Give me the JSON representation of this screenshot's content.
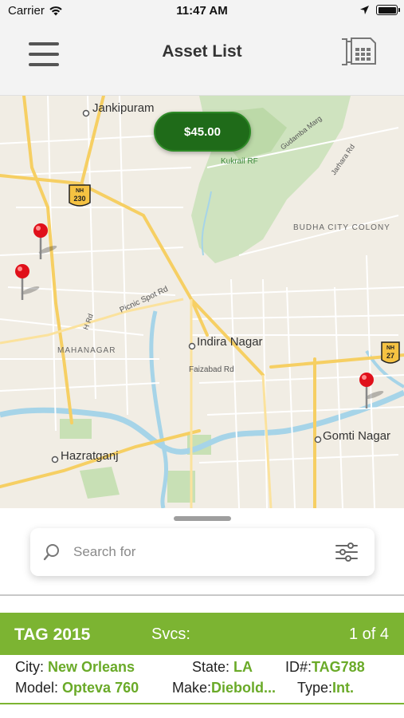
{
  "status_bar": {
    "carrier": "Carrier",
    "time": "11:47 AM"
  },
  "nav": {
    "title": "Asset List",
    "menu_icon": "hamburger-menu-icon",
    "right_icon": "sim-card-icon"
  },
  "map": {
    "price_badge": "$45.00",
    "labels": {
      "jankipuram": "Jankipuram",
      "kukrail": "Kukrail RF",
      "gudamba": "Gudamba Marg",
      "jarhara": "Jarhara Rd",
      "budha": "BUDHA CITY COLONY",
      "picnic": "Picnic Spot Rd",
      "hrd": "H Rd",
      "mahanagar": "MAHANAGAR",
      "indira": "Indira Nagar",
      "faizabad": "Faizabad Rd",
      "gomti": "Gomti Nagar",
      "hazratganj": "Hazratganj",
      "nh230": "230",
      "nh27": "27",
      "nh": "NH"
    },
    "pins": 3
  },
  "search": {
    "placeholder": "Search for",
    "value": ""
  },
  "asset": {
    "tag": "TAG 2015",
    "svcs_label": "Svcs:",
    "count": "1 of 4",
    "city_label": "City:",
    "city": "New Orleans",
    "state_label": "State:",
    "state": "LA",
    "id_label": "ID#:",
    "id": "TAG788",
    "model_label": "Model:",
    "model": "Opteva 760",
    "make_label": "Make:",
    "make": "Diebold...",
    "type_label": "Type:",
    "type": "Int."
  },
  "colors": {
    "accent_green": "#7cb432",
    "badge_green": "#1f6b19",
    "pin_red": "#e0101a"
  }
}
